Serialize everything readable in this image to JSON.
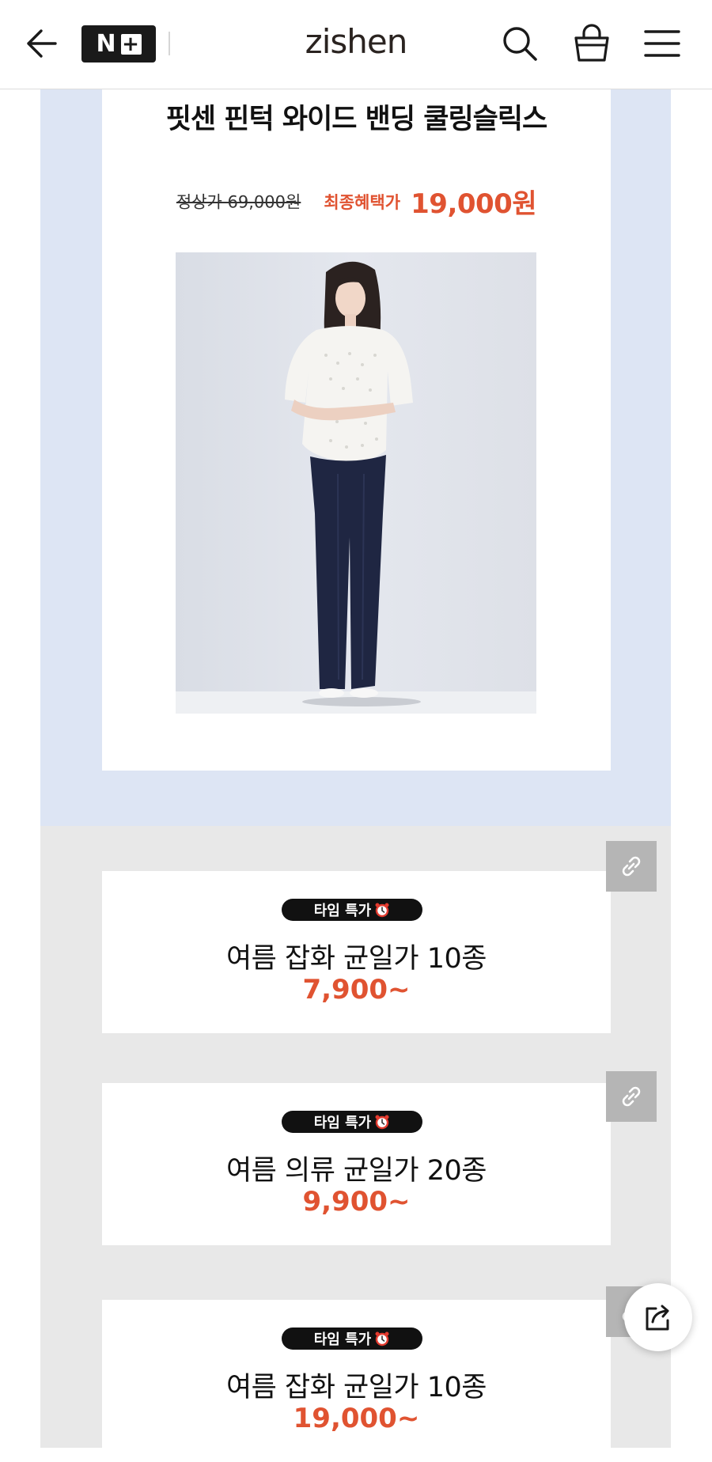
{
  "header": {
    "brand": "zishen",
    "badge_n": "N",
    "badge_plus": "+",
    "icons": {
      "back": "arrow-left-icon",
      "search": "search-icon",
      "bag": "shopping-bag-icon",
      "menu": "hamburger-menu-icon"
    }
  },
  "promo": {
    "background_color": "#dde5f4",
    "title": "핏센 핀턱 와이드 밴딩 쿨링슬릭스",
    "original_price": "정상가 69,000원",
    "final_label": "최종혜택가",
    "final_price": "19,000원",
    "accent_color": "#e05331"
  },
  "deals": [
    {
      "badge": "타임 특가",
      "title": "여름 잡화 균일가 10종",
      "price": "7,900~"
    },
    {
      "badge": "타임 특가",
      "title": "여름 의류 균일가 20종",
      "price": "9,900~"
    },
    {
      "badge": "타임 특가",
      "title": "여름 잡화 균일가 10종",
      "price": "19,000~"
    }
  ],
  "icons": {
    "deal_link": "link-icon",
    "badge_alarm": "alarm-clock-icon",
    "share": "share-icon"
  }
}
